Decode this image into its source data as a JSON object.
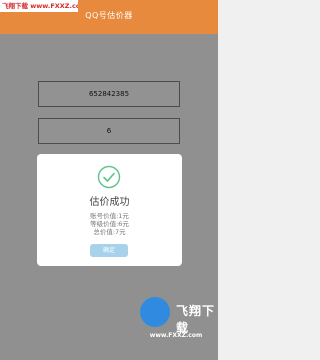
{
  "watermark_top": "飞翔下载 www.FXXZ.com",
  "header": {
    "title": "QQ号估价器"
  },
  "inputs": {
    "qq_number": "652842385",
    "level": "6"
  },
  "dialog": {
    "icon": "check-icon",
    "title": "估价成功",
    "lines": [
      "账号价值:1元",
      "等级价值:6元",
      "总价值:7元"
    ],
    "ok_label": "确定"
  },
  "watermark_logo": {
    "name": "飞翔下载",
    "url": "www.FXXZ.com"
  },
  "colors": {
    "header": "#e88a3d",
    "ok_button": "#a8d1ec",
    "check": "#5cc28a"
  }
}
